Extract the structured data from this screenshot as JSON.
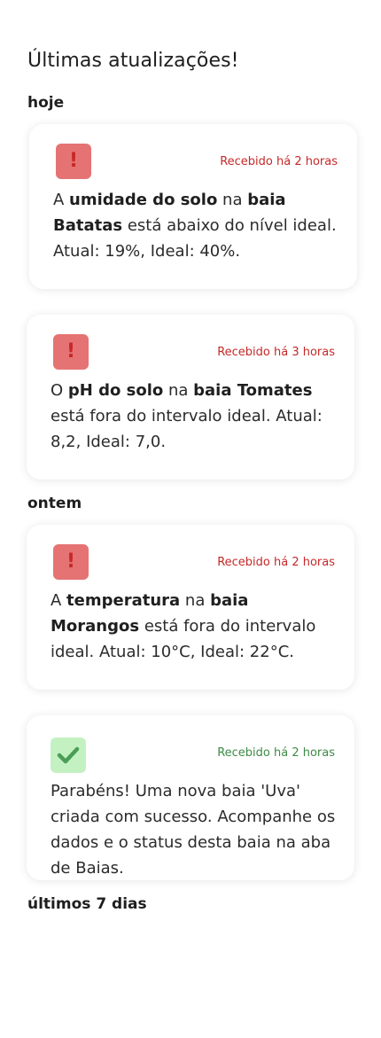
{
  "page": {
    "title": "Últimas atualizações!"
  },
  "sections": [
    {
      "label": "hoje"
    },
    {
      "label": "ontem"
    },
    {
      "label": "últimos 7 dias"
    }
  ],
  "colors": {
    "alert_badge": "#e57373",
    "alert_text": "#c62828",
    "success_badge": "#c4f1c2",
    "success_text": "#3d8b45"
  },
  "cards": [
    {
      "type": "alert",
      "icon": "exclamation-icon",
      "received": "Recebido há 2 horas",
      "parts": [
        "A ",
        "umidade do solo",
        " na ",
        "baia Batatas",
        " está abaixo do nível ideal. Atual: 19%, Ideal: 40%."
      ]
    },
    {
      "type": "alert",
      "icon": "exclamation-icon",
      "received": "Recebido há 3 horas",
      "parts": [
        "O ",
        "pH do solo",
        " na ",
        "baia Tomates",
        " está fora do intervalo ideal. Atual: 8,2, Ideal: 7,0."
      ]
    },
    {
      "type": "alert",
      "icon": "exclamation-icon",
      "received": "Recebido há 2 horas",
      "parts": [
        "A ",
        "temperatura",
        " na ",
        "baia Morangos",
        " está fora do intervalo ideal. Atual: 10°C, Ideal: 22°C."
      ]
    },
    {
      "type": "success",
      "icon": "check-icon",
      "received": "Recebido há 2 horas",
      "text": "Parabéns! Uma nova baia 'Uva' criada com sucesso. Acompanhe os dados e o status desta baia na aba de Baias."
    }
  ]
}
